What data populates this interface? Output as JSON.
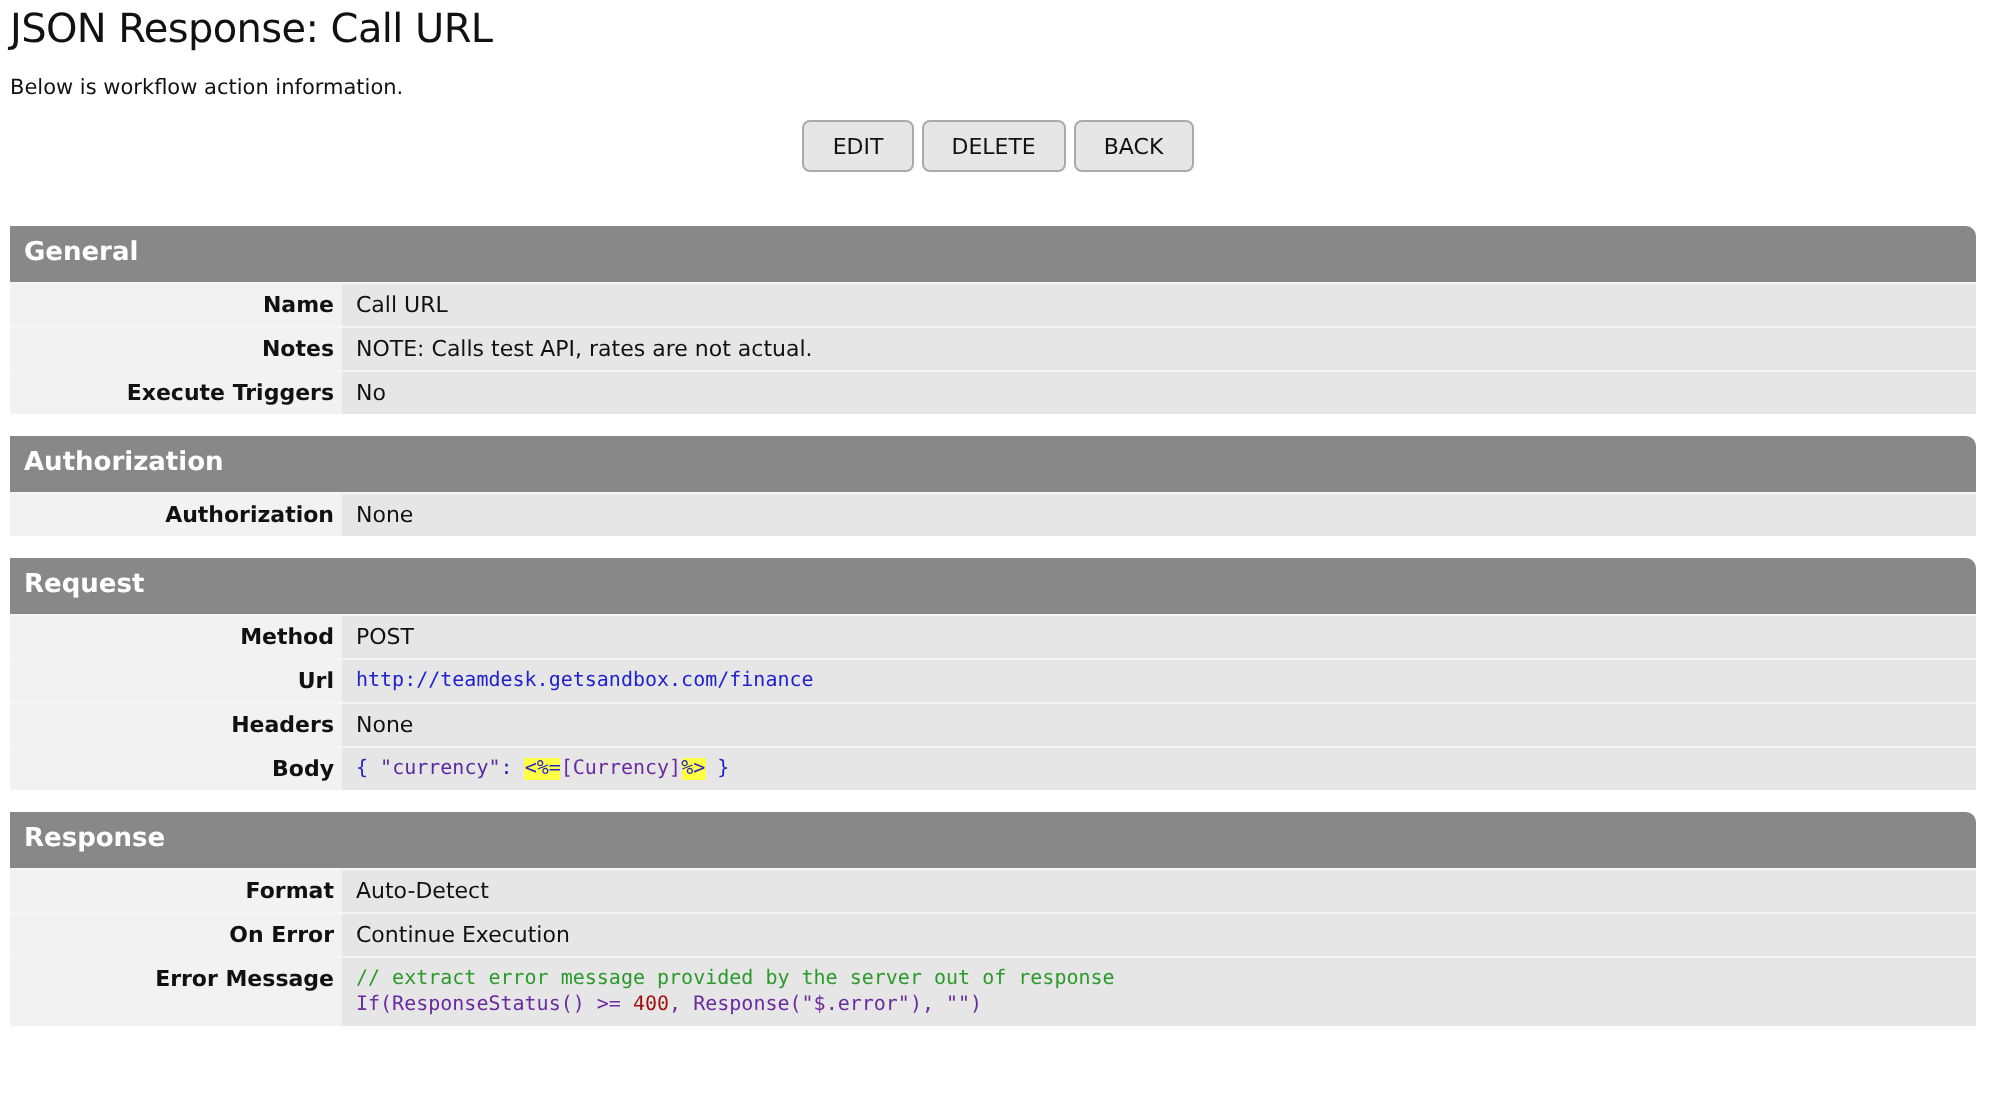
{
  "page": {
    "title": "JSON Response: Call URL",
    "subtitle": "Below is workflow action information."
  },
  "buttons": [
    "EDIT",
    "DELETE",
    "BACK"
  ],
  "sections": [
    {
      "title": "General",
      "rows": [
        {
          "label": "Name",
          "kind": "text",
          "value": "Call URL"
        },
        {
          "label": "Notes",
          "kind": "text",
          "value": "NOTE: Calls test API, rates are not actual."
        },
        {
          "label": "Execute Triggers",
          "kind": "text",
          "value": "No"
        }
      ]
    },
    {
      "title": "Authorization",
      "rows": [
        {
          "label": "Authorization",
          "kind": "text",
          "value": "None"
        }
      ]
    },
    {
      "title": "Request",
      "rows": [
        {
          "label": "Method",
          "kind": "text",
          "value": "POST"
        },
        {
          "label": "Url",
          "kind": "link",
          "value": "http://teamdesk.getsandbox.com/finance"
        },
        {
          "label": "Headers",
          "kind": "text",
          "value": "None"
        },
        {
          "label": "Body",
          "kind": "code",
          "lines": [
            [
              {
                "kind": "punct",
                "text": "{ "
              },
              {
                "kind": "string",
                "text": "\"currency\""
              },
              {
                "kind": "punct",
                "text": ": "
              },
              {
                "kind": "tag",
                "text": "<%="
              },
              {
                "kind": "func",
                "text": "[Currency]"
              },
              {
                "kind": "tag",
                "text": "%>"
              },
              {
                "kind": "punct",
                "text": " }"
              }
            ]
          ]
        }
      ]
    },
    {
      "title": "Response",
      "rows": [
        {
          "label": "Format",
          "kind": "text",
          "value": "Auto-Detect"
        },
        {
          "label": "On Error",
          "kind": "text",
          "value": "Continue Execution"
        },
        {
          "label": "Error Message",
          "kind": "code",
          "lines": [
            [
              {
                "kind": "comment",
                "text": "// extract error message provided by the server out of response"
              }
            ],
            [
              {
                "kind": "func",
                "text": "If(ResponseStatus() >= "
              },
              {
                "kind": "number",
                "text": "400"
              },
              {
                "kind": "func",
                "text": ", Response(\"$.error\"), \"\")"
              }
            ]
          ]
        }
      ]
    }
  ]
}
